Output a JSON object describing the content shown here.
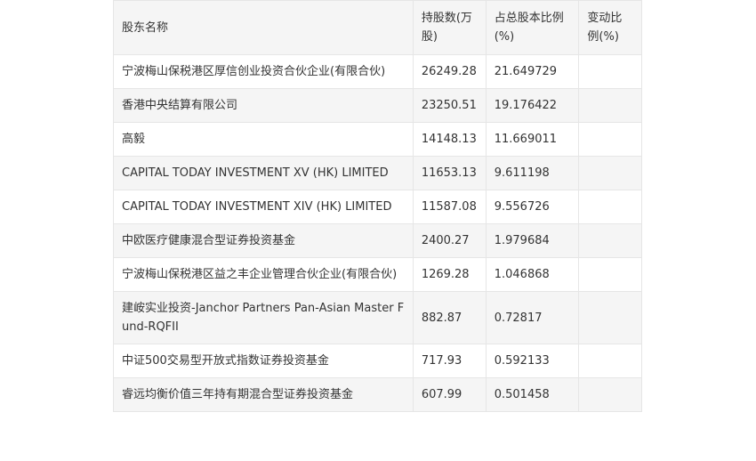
{
  "table": {
    "headers": [
      "股东名称",
      "持股数(万股)",
      "占总股本比例(%)",
      "变动比例(%)"
    ],
    "rows": [
      [
        "宁波梅山保税港区厚信创业投资合伙企业(有限合伙)",
        "26249.28",
        "21.649729",
        ""
      ],
      [
        "香港中央结算有限公司",
        "23250.51",
        "19.176422",
        ""
      ],
      [
        "高毅",
        "14148.13",
        "11.669011",
        ""
      ],
      [
        "CAPITAL TODAY INVESTMENT XV (HK) LIMITED",
        "11653.13",
        "9.611198",
        ""
      ],
      [
        "CAPITAL TODAY INVESTMENT XIV (HK) LIMITED",
        "11587.08",
        "9.556726",
        ""
      ],
      [
        "中欧医疗健康混合型证券投资基金",
        "2400.27",
        "1.979684",
        ""
      ],
      [
        "宁波梅山保税港区益之丰企业管理合伙企业(有限合伙)",
        "1269.28",
        "1.046868",
        ""
      ],
      [
        "建峖实业投资-Janchor Partners Pan-Asian Master Fund-RQFII",
        "882.87",
        "0.72817",
        ""
      ],
      [
        "中证500交易型开放式指数证券投资基金",
        "717.93",
        "0.592133",
        ""
      ],
      [
        "睿远均衡价值三年持有期混合型证券投资基金",
        "607.99",
        "0.501458",
        ""
      ]
    ]
  }
}
